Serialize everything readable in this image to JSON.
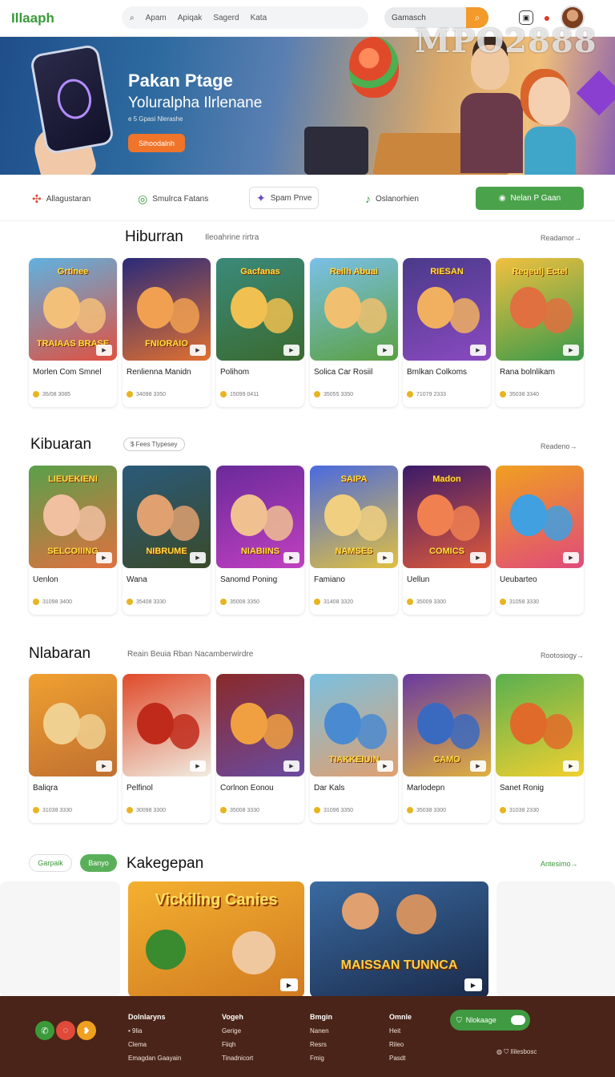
{
  "header": {
    "logo": "Illaaph",
    "nav": [
      "Apam",
      "Apiqak",
      "Sagerd",
      "Kata"
    ],
    "search_placeholder": "Gamasch",
    "watermark": "MPO2888"
  },
  "hero": {
    "title": "Pakan Ptage",
    "subtitle": "Yoluralpha Ilrlenane",
    "small": "e 5 Gpasi Nlerashe",
    "button": "Sihoodalnh"
  },
  "categories": [
    {
      "label": "Allagustaran",
      "icon": "pinwheel-icon"
    },
    {
      "label": "Smulrca Fatans",
      "icon": "gamepad-icon"
    },
    {
      "label": "Spam Pnve",
      "icon": "sparkle-icon"
    },
    {
      "label": "Oslanorhien",
      "icon": "music-note-icon"
    }
  ],
  "category_cta": "Nelan P Gaan",
  "sections": [
    {
      "title": "Hiburran",
      "subtitle": "Ileoahrine rirtra",
      "more": "Readamor→",
      "cards": [
        {
          "name": "Morlen Com Smnel",
          "stat": "35/08 3085",
          "art_text": "TRAIAAS BRASE",
          "top_text": "Grtinee",
          "colors": [
            "#5fb2e0",
            "#e05040",
            "#f3c07a"
          ]
        },
        {
          "name": "Renlienna Manidn",
          "stat": "34098 3350",
          "art_text": "FNIORAIO",
          "top_text": "",
          "colors": [
            "#2a2a7a",
            "#e07030",
            "#f0a050"
          ]
        },
        {
          "name": "Polihom",
          "stat": "15099 0411",
          "art_text": "",
          "top_text": "Gacfanas",
          "colors": [
            "#3a8a7a",
            "#3a6a30",
            "#f0c050"
          ]
        },
        {
          "name": "Solica Car Rosiil",
          "stat": "35055 3350",
          "art_text": "",
          "top_text": "Reilh Abuai",
          "colors": [
            "#7ac0e8",
            "#5aa040",
            "#f0c070"
          ]
        },
        {
          "name": "Bmlkan Colkoms",
          "stat": "71079 2333",
          "art_text": "",
          "top_text": "RIESAN",
          "colors": [
            "#4a3a8a",
            "#8a4ac0",
            "#f0b060"
          ]
        },
        {
          "name": "Rana bolnlikam",
          "stat": "35038 3340",
          "art_text": "",
          "top_text": "Reqeulj Ectel",
          "colors": [
            "#f0c040",
            "#3a9a4a",
            "#e07040"
          ]
        }
      ]
    },
    {
      "title": "Kibuaran",
      "subtitle": "",
      "tag": "$ Fees Tlypesey",
      "more": "Readeno→",
      "cards": [
        {
          "name": "Uenlon",
          "stat": "31098 3400",
          "art_text": "SELCOIIING",
          "top_text": "LIEUEKIENI",
          "colors": [
            "#5aa04a",
            "#e07040",
            "#f0c0a0"
          ]
        },
        {
          "name": "Wana",
          "stat": "35408 3330",
          "art_text": "NIBRUME",
          "top_text": "",
          "colors": [
            "#2a5a7a",
            "#3a4a2a",
            "#e0a070"
          ]
        },
        {
          "name": "Sanomd Poning",
          "stat": "35008 3350",
          "art_text": "NIABIINS",
          "top_text": "",
          "colors": [
            "#6a2a9a",
            "#c040c0",
            "#f0c090"
          ]
        },
        {
          "name": "Famiano",
          "stat": "31408 3320",
          "art_text": "NAMSES",
          "top_text": "SAIPA",
          "colors": [
            "#4a6ae0",
            "#e0c040",
            "#f0d080"
          ]
        },
        {
          "name": "Uellun",
          "stat": "35009 3300",
          "art_text": "COMICS",
          "top_text": "Madon",
          "colors": [
            "#3a1a6a",
            "#e05a3a",
            "#f08050"
          ]
        },
        {
          "name": "Ueubarteo",
          "stat": "31058 3330",
          "art_text": "",
          "top_text": "",
          "colors": [
            "#f0a020",
            "#e04a7a",
            "#40a0e0"
          ]
        }
      ]
    },
    {
      "title": "Nlabaran",
      "subtitle": "Reain Beuia Rban   Nacamberwirdre",
      "more": "Rootosiogy→",
      "cards": [
        {
          "name": "Baliqra",
          "stat": "31038 3330",
          "art_text": "",
          "top_text": "",
          "colors": [
            "#f0a030",
            "#c07030",
            "#f0d090"
          ]
        },
        {
          "name": "Pelfinol",
          "stat": "30098 3300",
          "art_text": "",
          "top_text": "",
          "colors": [
            "#e04a2a",
            "#f0ece0",
            "#c02a1a"
          ]
        },
        {
          "name": "Corlnon Eonou",
          "stat": "35008 3330",
          "art_text": "",
          "top_text": "",
          "colors": [
            "#8a2a2a",
            "#6a4aa0",
            "#f0a040"
          ]
        },
        {
          "name": "Dar Kals",
          "stat": "31096 3350",
          "art_text": "TIAKKEIUIN",
          "top_text": "",
          "colors": [
            "#7ac0e0",
            "#e0a070",
            "#4a8ad0"
          ]
        },
        {
          "name": "Marlodepn",
          "stat": "35038 3300",
          "art_text": "CAMO",
          "top_text": "",
          "colors": [
            "#6a3aa0",
            "#e0b040",
            "#3a6ac0"
          ]
        },
        {
          "name": "Sanet Ronig",
          "stat": "31038 2330",
          "art_text": "",
          "top_text": "",
          "colors": [
            "#5ab050",
            "#f0d030",
            "#e06a2a"
          ]
        }
      ]
    }
  ],
  "featured": {
    "pill_left": "Garpaik",
    "pill_active": "Banyo",
    "title": "Kakegepan",
    "more": "Antesimo→",
    "items": [
      {
        "text": "Vickiling Canies",
        "colors": [
          "#f0a020",
          "#3a8a30"
        ]
      },
      {
        "text": "MAISSAN TUNNCA",
        "colors": [
          "#2a5a8a",
          "#1a2a4a"
        ]
      }
    ]
  },
  "footer": {
    "cols": [
      {
        "head": "Dolnlaryns",
        "items": [
          "• 9lia",
          "Clema",
          "Emagdan Gaayain"
        ]
      },
      {
        "head": "Vogeh",
        "items": [
          "Gerige",
          "Fiiqh",
          "Tinadnicort"
        ]
      },
      {
        "head": "Bmgin",
        "items": [
          "Nanen",
          "Resrs",
          "Fmig"
        ]
      },
      {
        "head": "Omnle",
        "items": [
          "Heit",
          "Rileo",
          "Pasdt"
        ]
      }
    ],
    "button": "Nlokaage",
    "small": "Ililesbosc"
  }
}
